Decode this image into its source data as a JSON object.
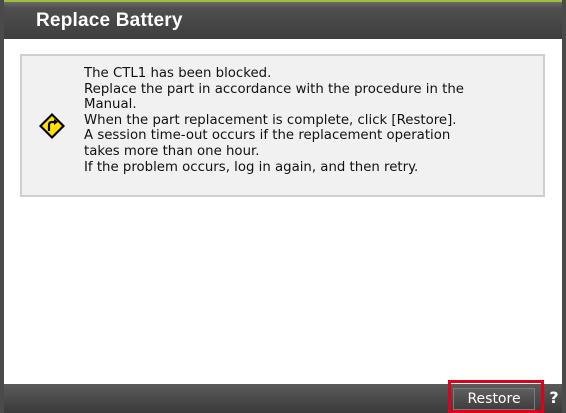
{
  "window": {
    "title": "Replace Battery"
  },
  "message": {
    "icon": "warning-diamond-icon",
    "lines": [
      "The CTL1 has been blocked.",
      "Replace the part in accordance with the procedure in the",
      "Manual.",
      "When the part replacement is complete, click [Restore].",
      "A session time-out occurs if the replacement operation",
      "takes more than one hour.",
      "If the problem occurs, log in again, and then retry."
    ]
  },
  "footer": {
    "restore_label": "Restore",
    "help_label": "?"
  },
  "colors": {
    "title_bar": "#4a4a4a",
    "accent_green": "#9fbf3a",
    "highlight_red": "#e0001a",
    "warning_yellow": "#ffe000"
  }
}
